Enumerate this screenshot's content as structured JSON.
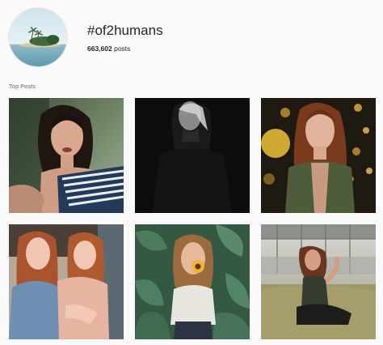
{
  "header": {
    "hashtag": "#of2humans",
    "post_count": "663,602",
    "post_count_suffix": " posts",
    "avatar_icon": "island-photo"
  },
  "top_posts": {
    "label": "Top Posts",
    "items": [
      {
        "name": "post-woman-striped-top",
        "icon": "portrait-photo"
      },
      {
        "name": "post-woman-dark-bw",
        "icon": "portrait-photo"
      },
      {
        "name": "post-woman-bokeh-lights",
        "icon": "portrait-photo"
      },
      {
        "name": "post-two-redheads",
        "icon": "portrait-photo"
      },
      {
        "name": "post-woman-sunflower",
        "icon": "portrait-photo"
      },
      {
        "name": "post-woman-sitting-grass",
        "icon": "portrait-photo"
      }
    ]
  },
  "colors": {
    "background": "#fafafa",
    "text": "#262626",
    "muted": "#8e8e8e"
  }
}
